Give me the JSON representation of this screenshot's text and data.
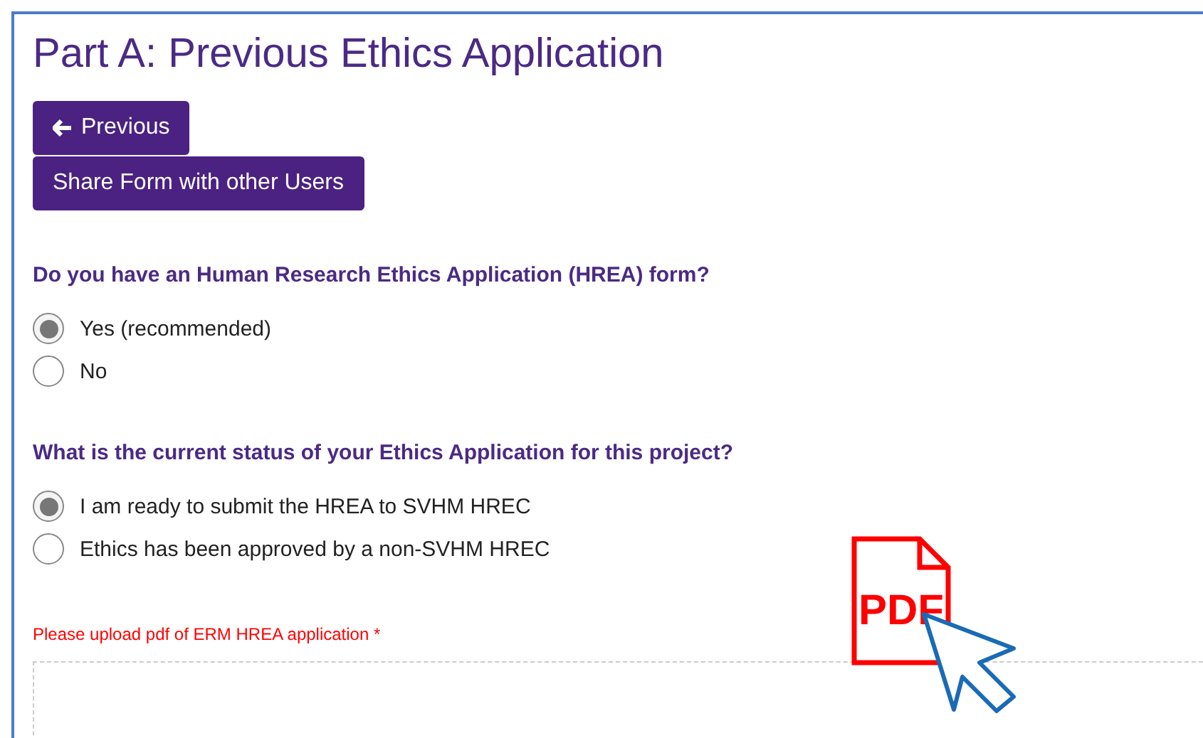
{
  "title": "Part A: Previous Ethics Application",
  "buttons": [
    {
      "kind": "back",
      "label": "Previous"
    },
    {
      "kind": "plain",
      "label": "Share Form with other Users"
    }
  ],
  "questions": [
    {
      "label": "Do you have an Human Research Ethics Application (HREA) form?",
      "options": [
        {
          "label": "Yes (recommended)",
          "selected": true
        },
        {
          "label": "No",
          "selected": false
        }
      ]
    },
    {
      "label": "What is the current status of your Ethics Application for this project?",
      "options": [
        {
          "label": "I am ready to submit the HREA to SVHM HREC",
          "selected": true
        },
        {
          "label": "Ethics has been approved by a non-SVHM HREC",
          "selected": false
        }
      ]
    }
  ],
  "upload": {
    "label": "Please upload pdf of ERM HREA application *"
  },
  "pdf_graphic": {
    "label": "PDF"
  }
}
